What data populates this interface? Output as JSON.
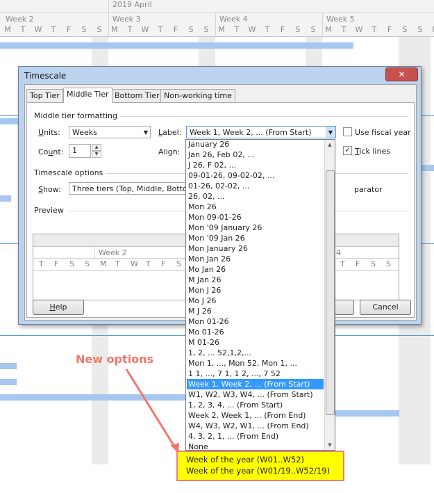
{
  "timeline": {
    "year_label": "2019 April",
    "weeks": [
      "Week 2",
      "Week 3",
      "Week 4",
      "Week 5"
    ],
    "days": [
      "M",
      "T",
      "W",
      "T",
      "F",
      "S",
      "S"
    ],
    "trailing_day": "M"
  },
  "dialog": {
    "title": "Timescale",
    "close_glyph": "✕",
    "tabs": [
      "Top Tier",
      "Middle Tier",
      "Bottom Tier",
      "Non-working time"
    ],
    "active_tab": "Middle Tier",
    "formatting_group": "Middle tier formatting",
    "units_label": "Units:",
    "units_value": "Weeks",
    "label_label": "Label:",
    "label_value": "Week 1, Week 2, ... (From Start)",
    "use_fiscal_year": {
      "label": "Use fiscal year",
      "checked": false
    },
    "count_label": "Count:",
    "count_value": "1",
    "align_label": "Align:",
    "tick_lines": {
      "label": "Tick lines",
      "checked": true
    },
    "timescale_options_group": "Timescale options",
    "show_label": "Show:",
    "show_value": "Three tiers (Top, Middle, Bottom)",
    "separator_partial": "parator",
    "preview_group": "Preview",
    "preview": {
      "middle_week_left": "Week 2",
      "middle_week_right": "k 4",
      "left_days": [
        "T",
        "F",
        "S",
        "S",
        "M",
        "T",
        "W",
        "T",
        "F",
        "S",
        "S"
      ],
      "right_days": [
        "T",
        "F",
        "S",
        "S"
      ]
    },
    "help_button": "Help",
    "ok_partial": "",
    "cancel_button": "Cancel"
  },
  "dropdown": {
    "items": [
      "January 26",
      "Jan 26, Feb 02, ...",
      "J 26, F 02, ...",
      "09-01-26, 09-02-02, ...",
      "01-26, 02-02, ...",
      "26, 02, ...",
      "Mon 26",
      "Mon 09-01-26",
      "Mon '09 January 26",
      "Mon '09 Jan 26",
      "Mon January 26",
      "Mon Jan 26",
      "Mo Jan 26",
      "M Jan 26",
      "Mon J 26",
      "Mo J 26",
      "M J 26",
      "Mon 01-26",
      "Mo 01-26",
      "M 01-26",
      "1, 2, ... 52,1,2,...",
      "Mon 1, ..., Mon 52, Mon 1, ...",
      "1 1, ..., 7 1, 1 2, ..., 7 52",
      "Week 1, Week 2, ... (From Start)",
      "W1, W2, W3, W4, ... (From Start)",
      "1, 2, 3, 4, ... (From Start)",
      "Week 2, Week 1, ... (From End)",
      "W4, W3, W2, W1, ... (From End)",
      "4, 3, 2, 1, ... (From End)",
      "None"
    ],
    "selected_index": 23,
    "new_options": [
      "Week of the year (W01..W52)",
      "Week of the year (W01/19..W52/19)"
    ]
  },
  "annotation": {
    "text": "New options",
    "color": "#f0776d"
  },
  "colors": {
    "selection": "#3399ff",
    "highlight": "#ffff00",
    "callout_border": "#e8817a"
  }
}
